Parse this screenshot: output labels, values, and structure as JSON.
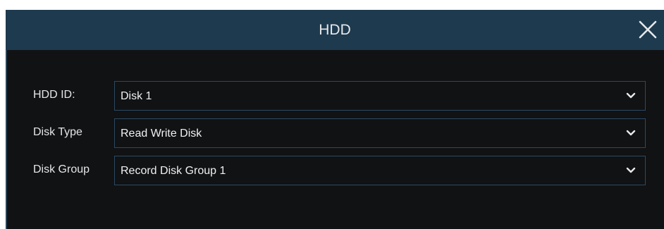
{
  "dialog": {
    "title": "HDD",
    "close_icon": "close-icon"
  },
  "fields": [
    {
      "label": "HDD ID:",
      "value": "Disk 1",
      "icon": "chevron-down-icon"
    },
    {
      "label": "Disk Type",
      "value": "Read Write Disk",
      "icon": "chevron-down-icon"
    },
    {
      "label": "Disk Group",
      "value": "Record Disk Group 1",
      "icon": "chevron-down-icon"
    }
  ],
  "colors": {
    "titlebar": "#1e3a4f",
    "body": "#111214",
    "select_border": "#2b4a63",
    "text": "#e6e8ea"
  }
}
